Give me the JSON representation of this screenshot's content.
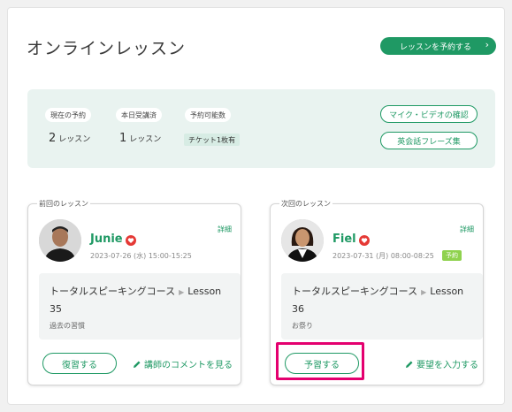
{
  "page": {
    "title": "オンラインレッスン",
    "reserve_button": "レッスンを予約する",
    "reserve_chevron": "›"
  },
  "summary": {
    "current_reservation": {
      "label": "現在の予約",
      "value": "2",
      "unit": "レッスン"
    },
    "today_taken": {
      "label": "本日受講済",
      "value": "1",
      "unit": "レッスン"
    },
    "bookable": {
      "label": "予約可能数",
      "value": "チケット1枚有"
    },
    "mic_video_button": "マイク・ビデオの確認",
    "phrases_button": "英会話フレーズ集"
  },
  "previous_lesson": {
    "legend": "前回のレッスン",
    "teacher": "Junie",
    "datetime": "2023-07-26 (水) 15:00-15:25",
    "detail": "詳細",
    "course": "トータルスピーキングコース",
    "arrow": "▶",
    "lesson_label": "Lesson",
    "lesson_number": "35",
    "note": "過去の習慣",
    "button": "復習する",
    "link": "講師のコメントを見る"
  },
  "next_lesson": {
    "legend": "次回のレッスン",
    "teacher": "Fiel",
    "datetime": "2023-07-31 (月) 08:00-08:25",
    "tag": "予約",
    "detail": "詳細",
    "course": "トータルスピーキングコース",
    "arrow": "▶",
    "lesson_label": "Lesson",
    "lesson_number": "36",
    "note": "お祭り",
    "button": "予習する",
    "link": "要望を入力する"
  },
  "colors": {
    "accent": "#1f9964",
    "summary_bg": "#e9f3f0",
    "heart": "#e53935",
    "highlight": "#e4006f",
    "tag_green": "#8fd24e"
  },
  "icons": [
    "heart-icon",
    "pencil-icon",
    "chevron-right-icon"
  ]
}
